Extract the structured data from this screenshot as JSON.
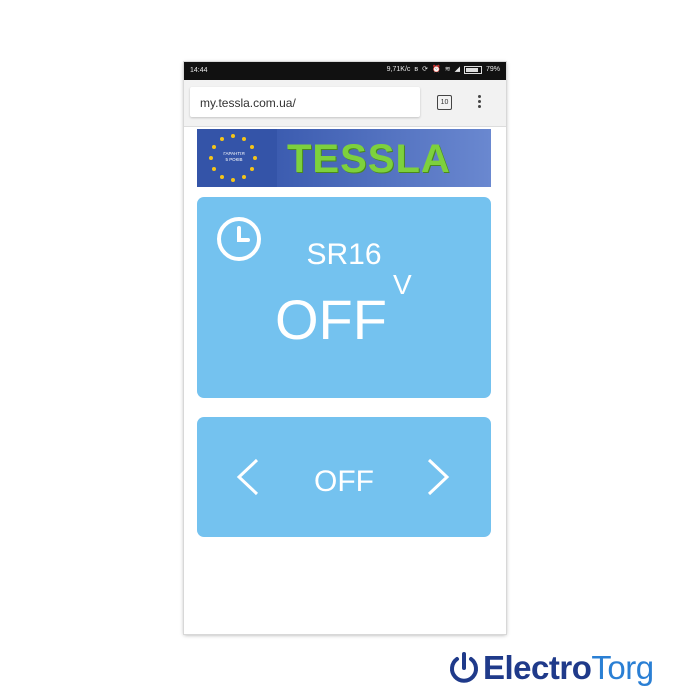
{
  "status_bar": {
    "time": "14:44",
    "speed": "9,71K/c",
    "battery": "79%"
  },
  "browser": {
    "url": "my.tessla.com.ua/",
    "tab_count": "10"
  },
  "banner": {
    "brand": "TESSLA",
    "badge_line1": "ГАРАНТІЯ",
    "badge_line2": "5 РОКІВ"
  },
  "device_card": {
    "device_name": "SR16",
    "state": "OFF",
    "mark": "V"
  },
  "mode_card": {
    "value": "OFF"
  },
  "watermark": {
    "part1": "Electro",
    "part2": "Torg"
  },
  "colors": {
    "card_bg": "#74c2ef",
    "banner_bg": "#3454a8",
    "brand_green": "#7dd13d",
    "watermark_dark": "#1f3a8a",
    "watermark_light": "#2a7fd4"
  }
}
